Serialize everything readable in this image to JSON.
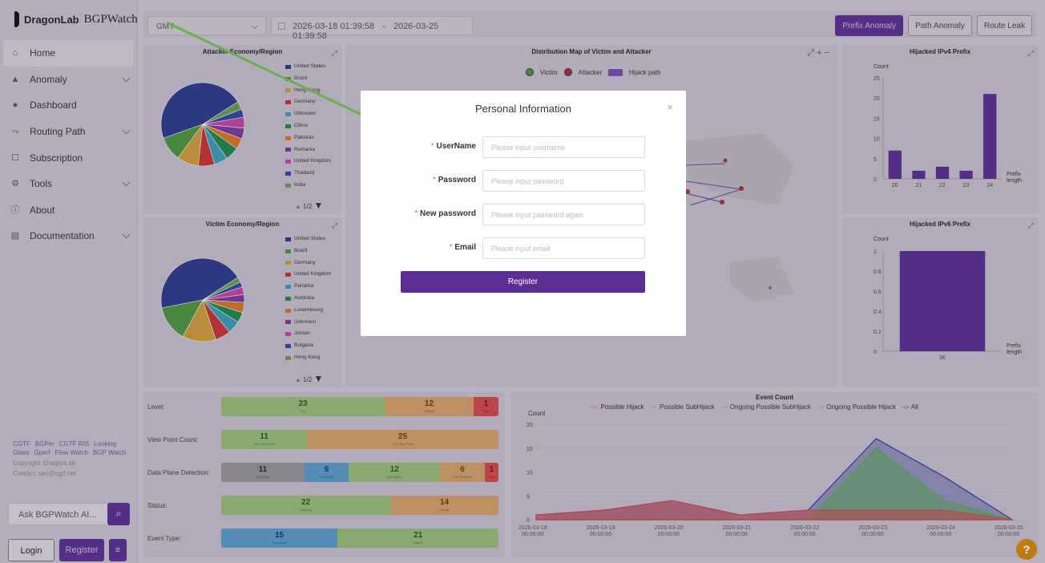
{
  "brand": {
    "name_a": "DragonLab",
    "name_b": "BGPWatch"
  },
  "nav": [
    {
      "label": "Home",
      "icon": "home-icon",
      "expandable": false,
      "active": true
    },
    {
      "label": "Anomaly",
      "icon": "warning-icon",
      "expandable": true
    },
    {
      "label": "Dashboard",
      "icon": "dashboard-icon",
      "expandable": false
    },
    {
      "label": "Routing Path",
      "icon": "route-icon",
      "expandable": true
    },
    {
      "label": "Subscription",
      "icon": "subscription-icon",
      "expandable": false
    },
    {
      "label": "Tools",
      "icon": "tools-icon",
      "expandable": true
    },
    {
      "label": "About",
      "icon": "info-icon",
      "expandable": false
    },
    {
      "label": "Documentation",
      "icon": "doc-icon",
      "expandable": true
    }
  ],
  "footer_links": [
    "CGTF",
    "BGPer",
    "CGTF RIS",
    "Looking Glass",
    "Gperf",
    "Flow Watch",
    "BGP Watch"
  ],
  "copyright": "Copyright :DragonLab",
  "contact": "Contact: sec@cgtf.net",
  "ask": {
    "label": "Ask BGPWatch AI..."
  },
  "auth": {
    "login": "Login",
    "register": "Register"
  },
  "topbar": {
    "timezone": "GMT",
    "date_start": "2026-03-18 01:39:58",
    "date_sep": "-",
    "date_end": "2026-03-25 01:39:58",
    "tabs": [
      "Prefix Anomaly",
      "Path Anomaly",
      "Route Leak"
    ]
  },
  "attacker_panel": {
    "title": "Attacker Economy/Region",
    "page": "1/2",
    "legend": [
      "United States",
      "Brazil",
      "Hong Kong",
      "Germany",
      "Unknown",
      "China",
      "Pakistan",
      "Romania",
      "United Kingdom",
      "Thailand",
      "India"
    ]
  },
  "victim_panel": {
    "title": "Victim Economy/Region",
    "page": "1/2",
    "legend": [
      "United States",
      "Brazil",
      "Germany",
      "United Kingdom",
      "Panama",
      "Australia",
      "Luxembourg",
      "Unknown",
      "Jordan",
      "Bulgaria",
      "Hong Kong"
    ]
  },
  "legend_colors": [
    "#2b3a8f",
    "#4a9a3c",
    "#d4a23a",
    "#cc3333",
    "#3aa0c0",
    "#1e8a4a",
    "#e07a20",
    "#7a3aa0",
    "#cc44aa",
    "#2a4aa0",
    "#6aa050"
  ],
  "map_panel": {
    "title": "Distribution Map of Victim and Attacker",
    "legend": [
      "Victim",
      "Attacker",
      "Hijack path"
    ]
  },
  "ipv4_panel": {
    "title": "Hijacked IPv4 Prefix",
    "ylabel": "Count",
    "xlabel_a": "Prefix",
    "xlabel_b": "length"
  },
  "ipv6_panel": {
    "title": "Hijacked IPv6 Prefix",
    "ylabel": "Count",
    "xlabel_a": "Prefix",
    "xlabel_b": "length"
  },
  "kpis": [
    {
      "label": "Level:",
      "segs": [
        {
          "v": "23",
          "s": "Low",
          "c": "#9cc47a",
          "w": 0.59
        },
        {
          "v": "12",
          "s": "Middle",
          "c": "#d9a56a",
          "w": 0.32
        },
        {
          "v": "1",
          "s": "High",
          "c": "#d94a4a",
          "w": 0.09
        }
      ]
    },
    {
      "label": "View Point Count:",
      "segs": [
        {
          "v": "11",
          "s": "<10 View Point",
          "c": "#9cc47a",
          "w": 0.31
        },
        {
          "v": "25",
          "s": ">10 View Point",
          "c": "#d9a56a",
          "w": 0.69
        }
      ]
    },
    {
      "label": "Data Plane Detection:",
      "segs": [
        {
          "v": "11",
          "s": "Not Done",
          "c": "#999999",
          "w": 0.3
        },
        {
          "v": "6",
          "s": "No Result",
          "c": "#5aa0d0",
          "w": 0.16
        },
        {
          "v": "12",
          "s": "Not Hijack",
          "c": "#9cc47a",
          "w": 0.33
        },
        {
          "v": "6",
          "s": "Low Possible",
          "c": "#d9a56a",
          "w": 0.16
        },
        {
          "v": "1",
          "s": "High Possible",
          "c": "#d94a4a",
          "w": 0.05
        }
      ]
    },
    {
      "label": "Status:",
      "segs": [
        {
          "v": "22",
          "s": "Ongoing",
          "c": "#9cc47a",
          "w": 0.61
        },
        {
          "v": "14",
          "s": "Ended",
          "c": "#d9a56a",
          "w": 0.39
        }
      ]
    },
    {
      "label": "Event Type:",
      "segs": [
        {
          "v": "15",
          "s": "SubHijack",
          "c": "#5aa0d0",
          "w": 0.42
        },
        {
          "v": "21",
          "s": "Hijack",
          "c": "#9cc47a",
          "w": 0.58
        }
      ]
    }
  ],
  "event_panel": {
    "title": "Event Count",
    "ylabel": "Count"
  },
  "modal": {
    "title": "Personal Information",
    "close": "×",
    "fields": [
      {
        "label": "UserName",
        "placeholder": "Please input username"
      },
      {
        "label": "Password",
        "placeholder": "Please input password"
      },
      {
        "label": "New password",
        "placeholder": "Please input password again"
      },
      {
        "label": "Email",
        "placeholder": "Please input email"
      }
    ],
    "submit": "Register"
  },
  "help": "?",
  "chart_data": [
    {
      "type": "pie",
      "title": "Attacker Economy/Region",
      "categories": [
        "United States",
        "Brazil",
        "Hong Kong",
        "Germany",
        "Unknown",
        "China",
        "Pakistan",
        "Romania",
        "United Kingdom",
        "Thailand",
        "India"
      ],
      "values": [
        44,
        9,
        8,
        6,
        5,
        5,
        4,
        4,
        4,
        3,
        3
      ]
    },
    {
      "type": "pie",
      "title": "Victim Economy/Region",
      "categories": [
        "United States",
        "Brazil",
        "Germany",
        "United Kingdom",
        "Panama",
        "Australia",
        "Luxembourg",
        "Unknown",
        "Jordan",
        "Bulgaria",
        "Hong Kong"
      ],
      "values": [
        44,
        14,
        13,
        6,
        5,
        4,
        4,
        3,
        3,
        2,
        2
      ]
    },
    {
      "type": "bar",
      "title": "Hijacked IPv4 Prefix",
      "categories": [
        "20",
        "21",
        "22",
        "23",
        "24"
      ],
      "values": [
        7,
        2,
        3,
        2,
        21
      ],
      "ylabel": "Count",
      "xlabel": "Prefix length",
      "ylim": [
        0,
        25
      ],
      "yticks": [
        0,
        5,
        10,
        15,
        20,
        25
      ]
    },
    {
      "type": "bar",
      "title": "Hijacked IPv6 Prefix",
      "categories": [
        "36"
      ],
      "values": [
        1
      ],
      "ylabel": "Count",
      "xlabel": "Prefix length",
      "ylim": [
        0,
        1
      ],
      "yticks": [
        "0",
        "0.2",
        "0.4",
        "0.6",
        "0.8",
        "1"
      ]
    },
    {
      "type": "area",
      "title": "Event Count",
      "ylabel": "Count",
      "ylim": [
        0,
        20
      ],
      "yticks": [
        0,
        5,
        10,
        15,
        20
      ],
      "x": [
        "2026-03-18 00:00:00",
        "2026-03-19 00:00:00",
        "2026-03-20 00:00:00",
        "2026-03-21 00:00:00",
        "2026-03-22 00:00:00",
        "2026-03-23 00:00:00",
        "2026-03-24 00:00:00",
        "2026-03-25 00:00:00"
      ],
      "series": [
        {
          "name": "Possible Hijack",
          "color": "#d94a4a",
          "values": [
            1,
            2,
            4,
            1,
            2,
            2,
            2,
            0
          ]
        },
        {
          "name": "Possible SubHijack",
          "color": "#e0a030",
          "values": [
            0,
            0,
            0,
            0,
            0,
            0,
            0,
            0
          ]
        },
        {
          "name": "Ongoing Possible SubHijack",
          "color": "#5ab050",
          "values": [
            0,
            0,
            0,
            0,
            0,
            15,
            4,
            0
          ]
        },
        {
          "name": "Ongoing Possible Hijack",
          "color": "#4aa0d0",
          "values": [
            0,
            0,
            0,
            0,
            0,
            0,
            0,
            0
          ]
        },
        {
          "name": "All",
          "color": "#2a3aa0",
          "values": [
            1,
            2,
            4,
            1,
            2,
            17,
            9,
            0
          ]
        }
      ]
    }
  ]
}
